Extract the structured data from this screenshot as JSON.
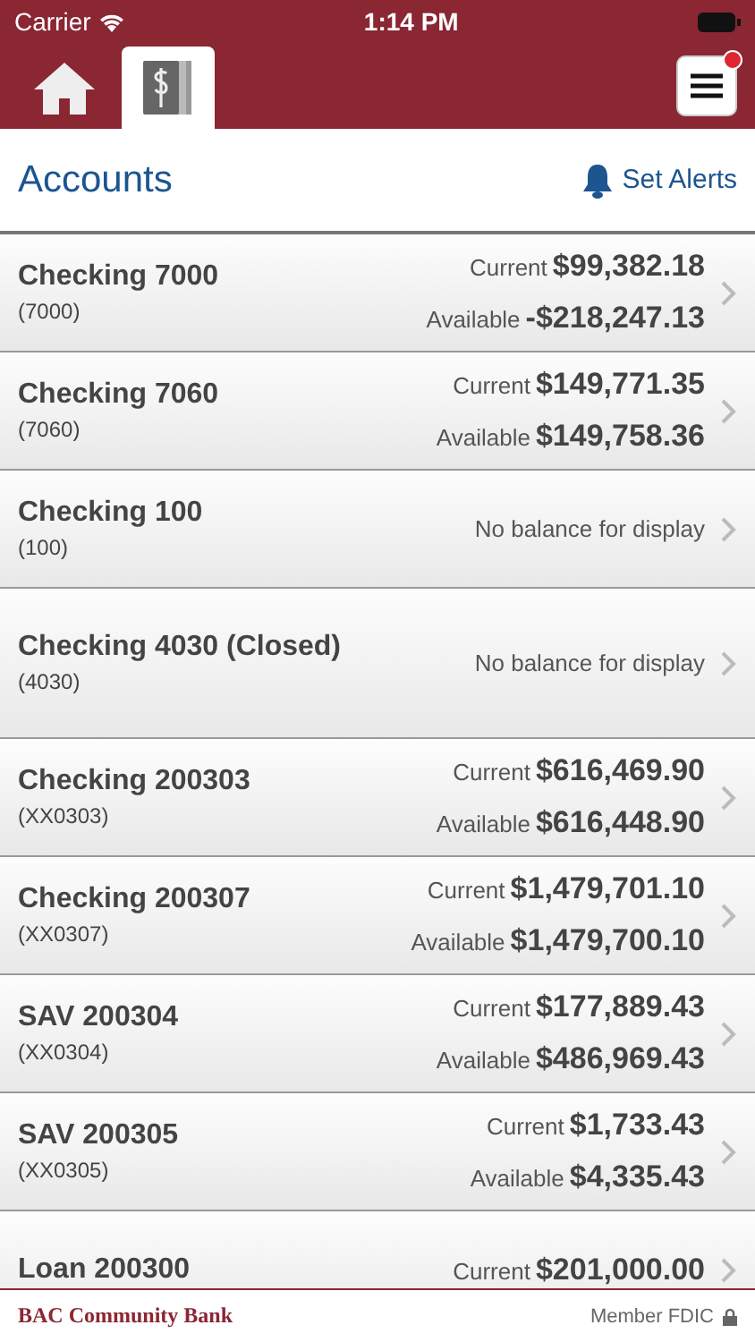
{
  "status_bar": {
    "carrier": "Carrier",
    "time": "1:14 PM"
  },
  "nav": {
    "tabs": [
      {
        "kind": "home",
        "selected": false
      },
      {
        "kind": "accounts",
        "selected": true
      }
    ],
    "menu_badge": true
  },
  "heading": {
    "title": "Accounts",
    "action": "Set Alerts"
  },
  "accounts": [
    {
      "name": "Checking 7000",
      "number": "(7000)",
      "kind": "open",
      "balances": [
        {
          "label": "Current",
          "amount": "$99,382.18"
        },
        {
          "label": "Available",
          "amount": "-$218,247.13"
        }
      ]
    },
    {
      "name": "Checking 7060",
      "number": "(7060)",
      "kind": "open",
      "balances": [
        {
          "label": "Current",
          "amount": "$149,771.35"
        },
        {
          "label": "Available",
          "amount": "$149,758.36"
        }
      ]
    },
    {
      "name": "Checking 100",
      "number": "(100)",
      "kind": "open",
      "note": "No balance for display"
    },
    {
      "name": "Checking 4030 (Closed)",
      "number": "(4030)",
      "kind": "closed",
      "note": "No balance for display"
    },
    {
      "name": "Checking 200303",
      "number": "(XX0303)",
      "kind": "open",
      "balances": [
        {
          "label": "Current",
          "amount": "$616,469.90"
        },
        {
          "label": "Available",
          "amount": "$616,448.90"
        }
      ]
    },
    {
      "name": "Checking 200307",
      "number": "(XX0307)",
      "kind": "open",
      "balances": [
        {
          "label": "Current",
          "amount": "$1,479,701.10"
        },
        {
          "label": "Available",
          "amount": "$1,479,700.10"
        }
      ]
    },
    {
      "name": "SAV 200304",
      "number": "(XX0304)",
      "kind": "open",
      "balances": [
        {
          "label": "Current",
          "amount": "$177,889.43"
        },
        {
          "label": "Available",
          "amount": "$486,969.43"
        }
      ]
    },
    {
      "name": "SAV 200305",
      "number": "(XX0305)",
      "kind": "open",
      "balances": [
        {
          "label": "Current",
          "amount": "$1,733.43"
        },
        {
          "label": "Available",
          "amount": "$4,335.43"
        }
      ]
    },
    {
      "name": "Loan 200300",
      "kind": "open",
      "balances": [
        {
          "label": "Current",
          "amount": "$201,000.00"
        }
      ]
    }
  ],
  "footer": {
    "bank": "BAC Community Bank",
    "member": "Member FDIC"
  }
}
